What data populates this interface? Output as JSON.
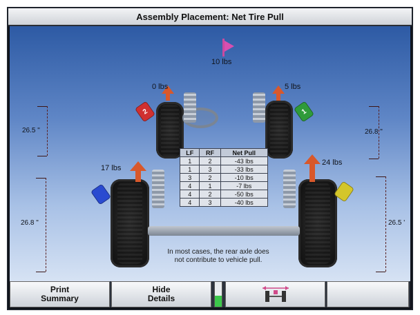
{
  "title": "Assembly Placement: Net Tire Pull",
  "vehicle": {
    "total_pull": "10 lbs",
    "lf_pull": "0 lbs",
    "rf_pull": "5 lbs",
    "lr_pull": "17 lbs",
    "rr_pull": "24 lbs",
    "dims": {
      "front_left": "26.5 \"",
      "front_right": "26.8 \"",
      "rear_left": "26.8 \"",
      "rear_right": "26.5 '"
    },
    "tags": {
      "rf": {
        "label": "1",
        "color": "#2f9b3a"
      },
      "lf": {
        "label": "2",
        "color": "#d03030"
      },
      "lr": {
        "label": "",
        "color": "#2a4bd0"
      },
      "rr": {
        "label": "",
        "color": "#d4c62a"
      }
    }
  },
  "table": {
    "headers": [
      "LF",
      "RF",
      "Net Pull"
    ],
    "rows": [
      [
        "1",
        "2",
        "-43 lbs"
      ],
      [
        "1",
        "3",
        "-33 lbs"
      ],
      [
        "3",
        "2",
        "-10 lbs"
      ],
      [
        "4",
        "1",
        "-7 lbs"
      ],
      [
        "4",
        "2",
        "-50 lbs"
      ],
      [
        "4",
        "3",
        "-40 lbs"
      ]
    ]
  },
  "note": "In most cases, the rear axle does not contribute to vehicle pull.",
  "toolbar": {
    "print_summary": [
      "Print",
      "Summary"
    ],
    "hide_details": [
      "Hide",
      "Details"
    ],
    "meter_level": 0.45
  }
}
